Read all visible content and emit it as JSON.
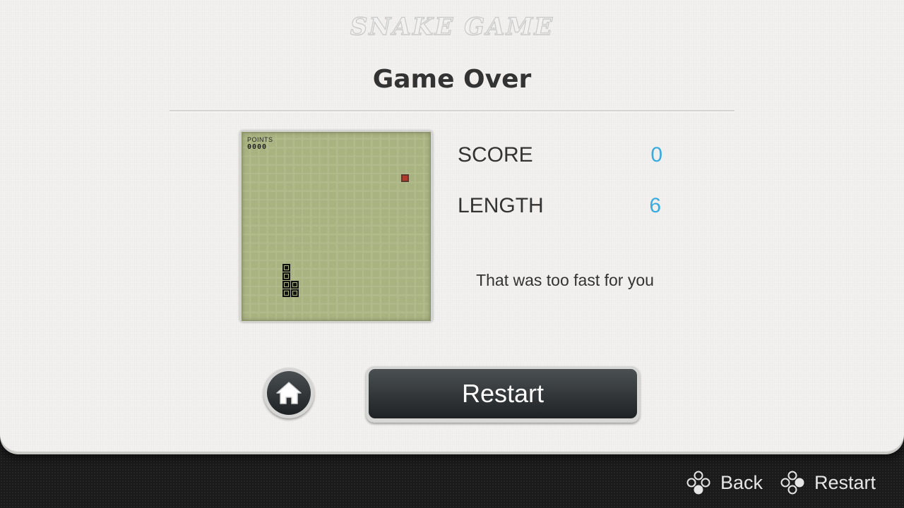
{
  "header": {
    "logo": "SNAKE GAME",
    "title": "Game Over"
  },
  "board": {
    "points_label": "POINTS",
    "points_value": "0000"
  },
  "stats": {
    "score_label": "SCORE",
    "score_value": "0",
    "length_label": "LENGTH",
    "length_value": "6"
  },
  "message": "That was too fast for you",
  "buttons": {
    "home_icon": "home-icon",
    "restart_label": "Restart"
  },
  "footer": {
    "back_label": "Back",
    "restart_label": "Restart",
    "icon": "gamepad-buttons-icon"
  },
  "colors": {
    "accent": "#3aabe0",
    "lcd": "#a9b382",
    "food": "#b03a2e",
    "button": "#2f3336"
  }
}
